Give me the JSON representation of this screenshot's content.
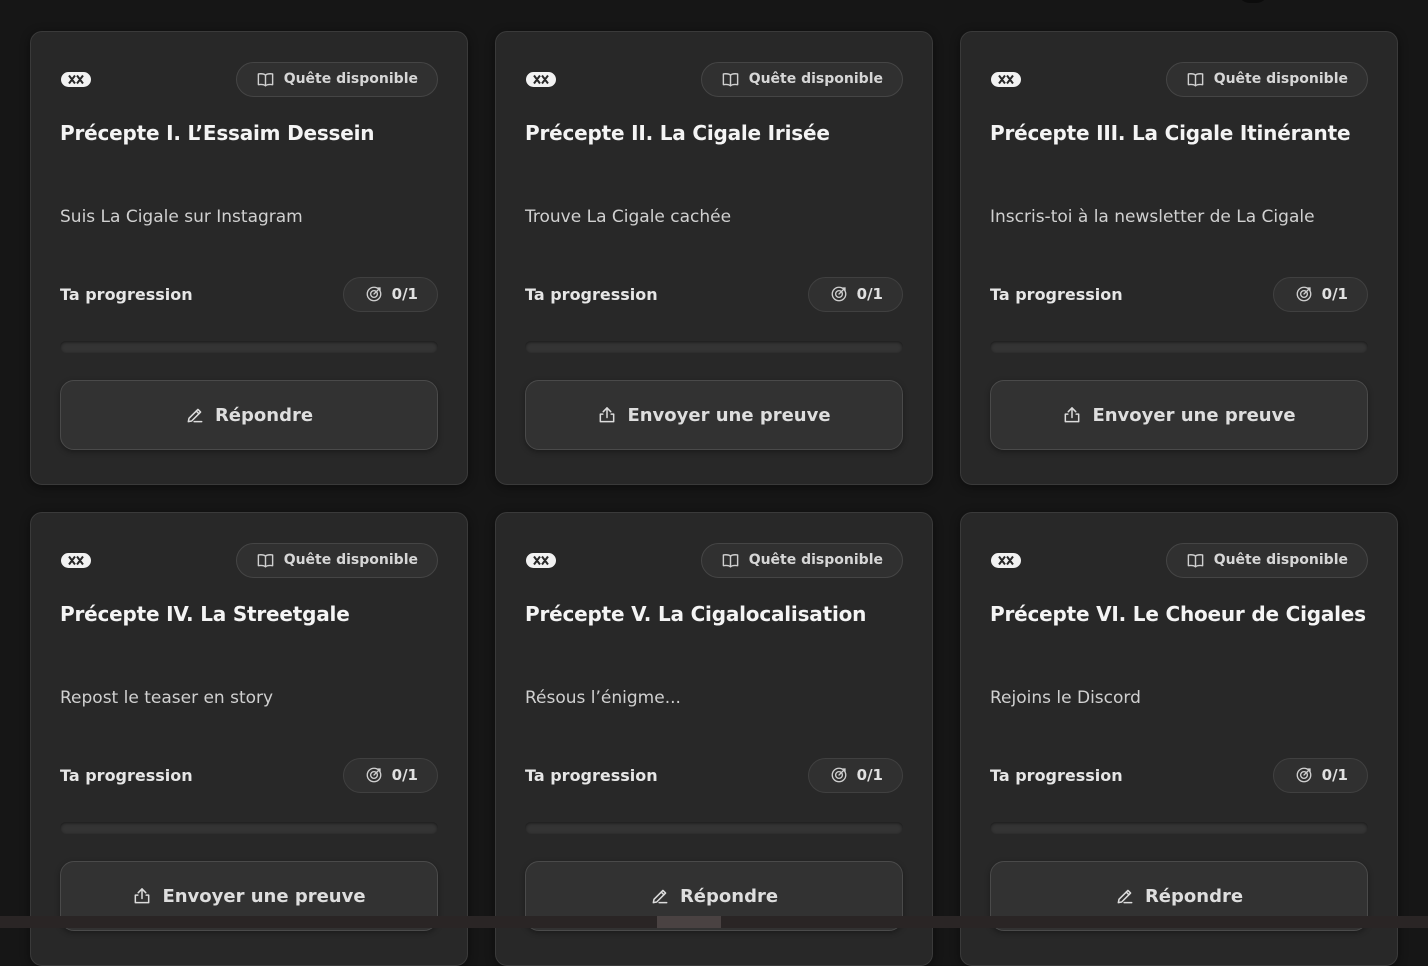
{
  "quests": [
    {
      "badge": "Quête disponible",
      "title": "Précepte I. L’Essaim Dessein",
      "description": "Suis La Cigale sur Instagram",
      "progress_label": "Ta progression",
      "count": "0/1",
      "progress": 0,
      "action": {
        "label": "Répondre",
        "icon": "pencil-icon"
      }
    },
    {
      "badge": "Quête disponible",
      "title": "Précepte II. La Cigale Irisée",
      "description": "Trouve La Cigale cachée",
      "progress_label": "Ta progression",
      "count": "0/1",
      "progress": 0,
      "action": {
        "label": "Envoyer une preuve",
        "icon": "upload-icon"
      }
    },
    {
      "badge": "Quête disponible",
      "title": "Précepte III. La Cigale Itinérante",
      "description": "Inscris-toi à la newsletter de La Cigale",
      "progress_label": "Ta progression",
      "count": "0/1",
      "progress": 0,
      "action": {
        "label": "Envoyer une preuve",
        "icon": "upload-icon"
      }
    },
    {
      "badge": "Quête disponible",
      "title": "Précepte IV. La Streetgale",
      "description": "Repost le teaser en story",
      "progress_label": "Ta progression",
      "count": "0/1",
      "progress": 0,
      "action": {
        "label": "Envoyer une preuve",
        "icon": "upload-icon"
      }
    },
    {
      "badge": "Quête disponible",
      "title": "Précepte V. La Cigalocalisation",
      "description": "Résous l’énigme...",
      "progress_label": "Ta progression",
      "count": "0/1",
      "progress": 0,
      "action": {
        "label": "Répondre",
        "icon": "pencil-icon"
      }
    },
    {
      "badge": "Quête disponible",
      "title": "Précepte VI. Le Choeur de Cigales",
      "description": "Rejoins le Discord",
      "progress_label": "Ta progression",
      "count": "0/1",
      "progress": 0,
      "action": {
        "label": "Répondre",
        "icon": "pencil-icon"
      }
    }
  ],
  "icons": {
    "card_corner": "ticket-icon",
    "badge": "book-open-icon",
    "count": "target-icon"
  },
  "colors": {
    "background": "#161616",
    "card": "#282828",
    "pill": "#303030",
    "text": "#f4f4f4"
  }
}
